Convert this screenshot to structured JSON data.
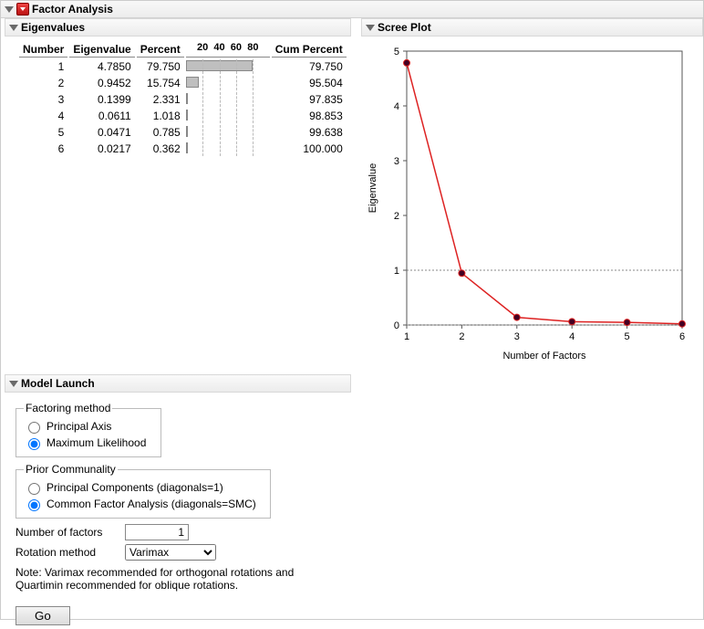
{
  "title": "Factor Analysis",
  "eigen": {
    "header": "Eigenvalues",
    "cols": {
      "number": "Number",
      "eigenvalue": "Eigenvalue",
      "percent": "Percent",
      "cum": "Cum Percent"
    },
    "ticks": [
      "20",
      "40",
      "60",
      "80"
    ],
    "rows": [
      {
        "n": "1",
        "ev": "4.7850",
        "pct": "79.750",
        "cum": "79.750"
      },
      {
        "n": "2",
        "ev": "0.9452",
        "pct": "15.754",
        "cum": "95.504"
      },
      {
        "n": "3",
        "ev": "0.1399",
        "pct": "2.331",
        "cum": "97.835"
      },
      {
        "n": "4",
        "ev": "0.0611",
        "pct": "1.018",
        "cum": "98.853"
      },
      {
        "n": "5",
        "ev": "0.0471",
        "pct": "0.785",
        "cum": "99.638"
      },
      {
        "n": "6",
        "ev": "0.0217",
        "pct": "0.362",
        "cum": "100.000"
      }
    ]
  },
  "scree": {
    "header": "Scree Plot",
    "xlabel": "Number of Factors",
    "ylabel": "Eigenvalue"
  },
  "chart_data": {
    "type": "line",
    "title": "Scree Plot",
    "xlabel": "Number of Factors",
    "ylabel": "Eigenvalue",
    "xlim": [
      1,
      6
    ],
    "ylim": [
      0,
      5
    ],
    "x": [
      1,
      2,
      3,
      4,
      5,
      6
    ],
    "values": [
      4.785,
      0.9452,
      0.1399,
      0.0611,
      0.0471,
      0.0217
    ],
    "ref_lines": [
      0,
      1
    ]
  },
  "model": {
    "header": "Model Launch",
    "fm_legend": "Factoring method",
    "fm_opts": {
      "pa": "Principal Axis",
      "ml": "Maximum Likelihood"
    },
    "fm_sel": "ml",
    "pc_legend": "Prior Communality",
    "pc_opts": {
      "pc": "Principal Components (diagonals=1)",
      "cfa": "Common Factor Analysis (diagonals=SMC)"
    },
    "pc_sel": "cfa",
    "nfact_label": "Number of factors",
    "nfact_value": "1",
    "rot_label": "Rotation method",
    "rot_value": "Varimax",
    "note": "Note: Varimax recommended for orthogonal rotations and Quartimin recommended for oblique rotations.",
    "go": "Go"
  }
}
